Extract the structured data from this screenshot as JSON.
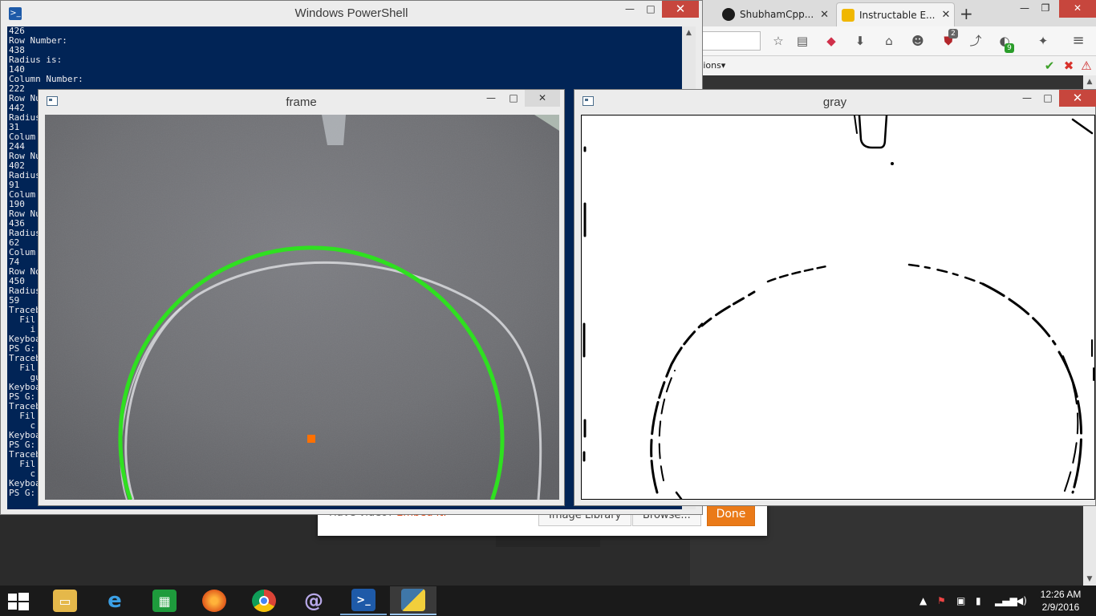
{
  "powershell": {
    "title": "Windows PowerShell",
    "lines": [
      "426",
      "Row Number:",
      "438",
      "Radius is:",
      "140",
      "Column Number:",
      "222",
      "Row Nu",
      "442",
      "Radius",
      "31",
      "Colum",
      "244",
      "Row Nu",
      "402",
      "Radius",
      "91",
      "Colum",
      "190",
      "Row Nu",
      "436",
      "Radius",
      "62",
      "Colum",
      "74",
      "Row No",
      "450",
      "Radius",
      "59",
      "Traceb",
      "  Fil",
      "    i",
      "Keyboa",
      "PS G:",
      "Traceb",
      "  Fil",
      "    gu",
      "Keyboa",
      "PS G:",
      "Traceb",
      "  Fil",
      "    c",
      "Keyboa",
      "PS G:",
      "Traceb",
      "  Fil",
      "    c",
      "Keyboa",
      "PS G:"
    ]
  },
  "frame_window": {
    "title": "frame"
  },
  "gray_window": {
    "title": "gray"
  },
  "browser": {
    "tabs": [
      {
        "label": "ShubhamCpp...",
        "favicon": "github-icon"
      },
      {
        "label": "Instructable E...",
        "favicon": "instructables-icon"
      }
    ],
    "new_tab_label": "+",
    "addon_badge_count": "2",
    "pocket_badge_count": "9",
    "bookmark_partial": "tions▾"
  },
  "dialog": {
    "partial_text_prefix": "Have video? ",
    "partial_text_link": "Embed it.",
    "image_library_label": "Image Library",
    "browse_label": "Browse...",
    "done_label": "Done"
  },
  "taskbar": {
    "time": "12:26 AM",
    "date": "2/9/2016"
  },
  "colors": {
    "ps_background": "#012456",
    "circle": "#2fe020",
    "center_marker": "#ff7000",
    "close_button": "#c7463d",
    "done_button": "#ea7a18"
  },
  "window_controls": {
    "minimize": "—",
    "maximize": "□",
    "close": "✕"
  }
}
